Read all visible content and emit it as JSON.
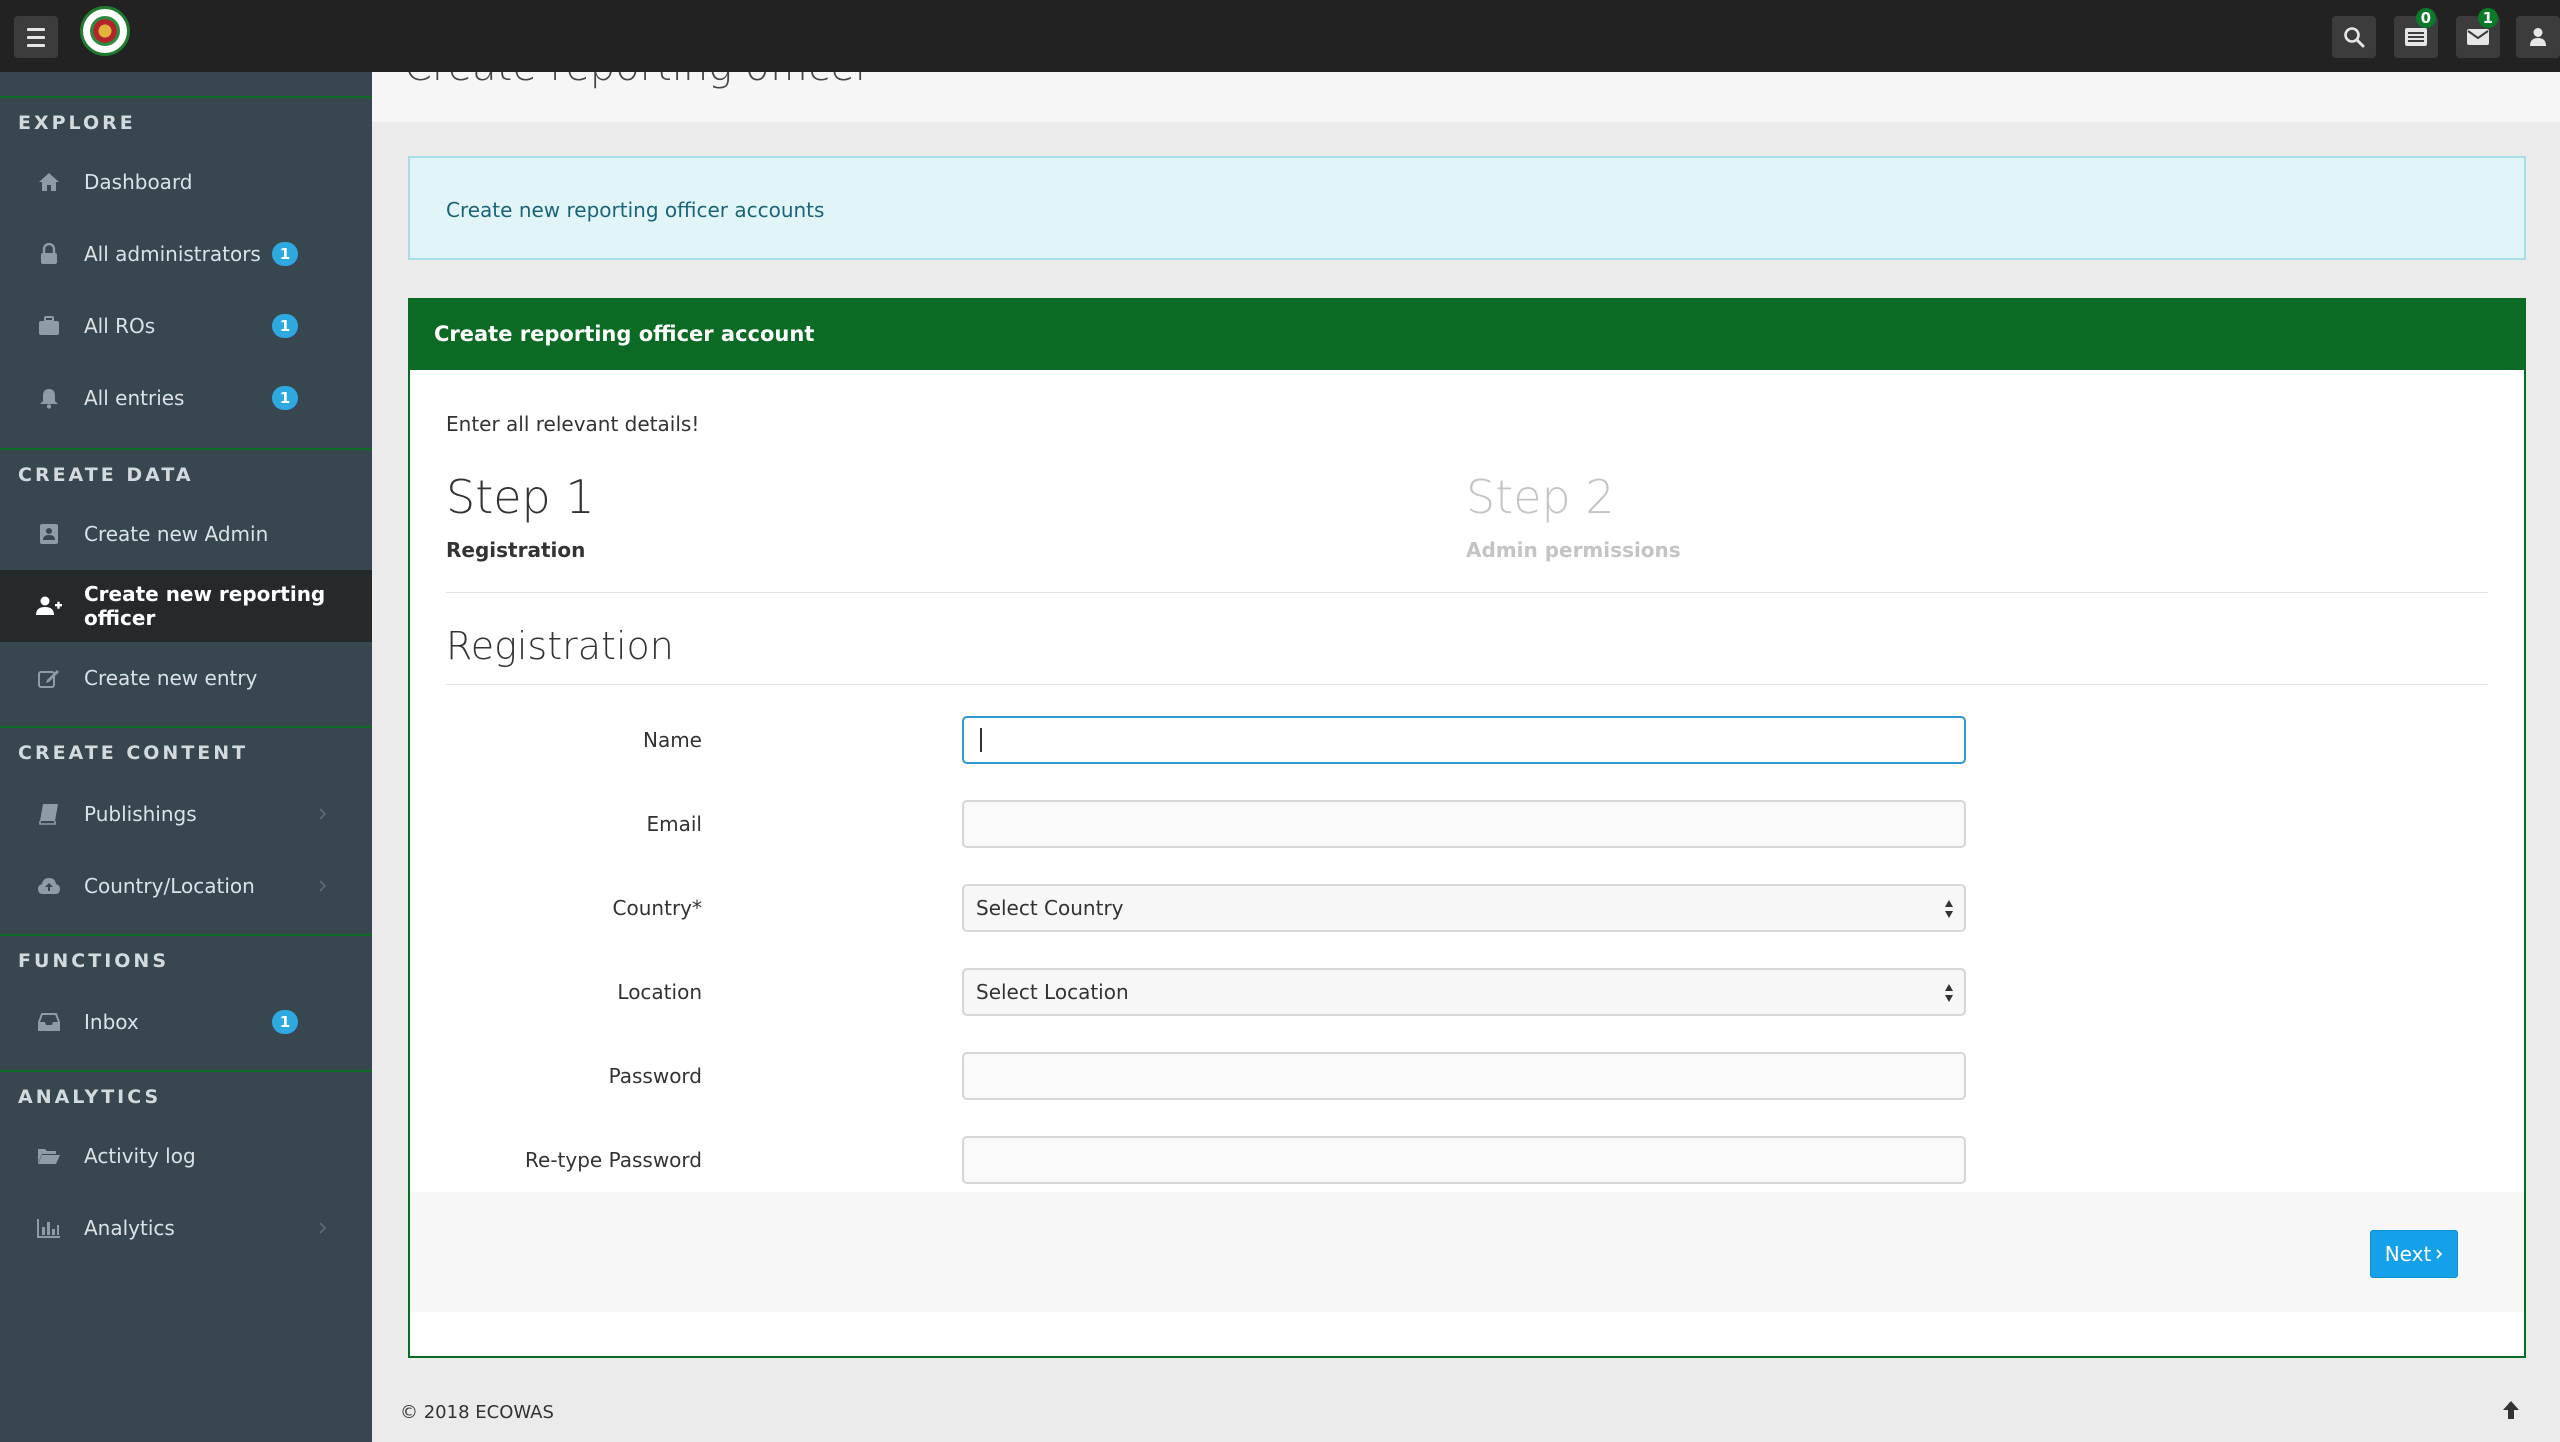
{
  "topbar": {
    "menu_icon": "hamburger-menu-icon",
    "logo_icon": "ecowas-logo-icon",
    "icons": [
      {
        "name": "search-icon"
      },
      {
        "name": "tasks-list-icon",
        "badge": "0"
      },
      {
        "name": "envelope-icon",
        "badge": "1"
      },
      {
        "name": "user-icon"
      }
    ]
  },
  "sidebar": {
    "sections": [
      {
        "title": "EXPLORE"
      },
      {
        "title": "CREATE DATA"
      },
      {
        "title": "CREATE CONTENT"
      },
      {
        "title": "FUNCTIONS"
      },
      {
        "title": "ANALYTICS"
      }
    ],
    "items": [
      {
        "label": "Dashboard",
        "icon": "home-icon"
      },
      {
        "label": "All administrators",
        "icon": "lock-icon",
        "badge": "1"
      },
      {
        "label": "All ROs",
        "icon": "briefcase-icon",
        "badge": "1"
      },
      {
        "label": "All entries",
        "icon": "bell-icon",
        "badge": "1"
      },
      {
        "label": "Create new Admin",
        "icon": "id-card-icon"
      },
      {
        "label": "Create new reporting officer",
        "icon": "user-plus-icon",
        "active": true
      },
      {
        "label": "Create new entry",
        "icon": "edit-icon"
      },
      {
        "label": "Publishings",
        "icon": "book-icon",
        "chevron": true
      },
      {
        "label": "Country/Location",
        "icon": "cloud-upload-icon",
        "chevron": true
      },
      {
        "label": "Inbox",
        "icon": "inbox-icon",
        "badge": "1"
      },
      {
        "label": "Activity log",
        "icon": "folder-open-icon"
      },
      {
        "label": "Analytics",
        "icon": "bar-chart-icon",
        "chevron": true
      }
    ]
  },
  "page": {
    "title": "Create reporting officer",
    "alert": "Create new reporting officer accounts",
    "panel_title": "Create reporting officer account",
    "intro": "Enter all relevant details!",
    "steps": [
      {
        "number": "Step 1",
        "label": "Registration"
      },
      {
        "number": "Step 2",
        "label": "Admin permissions"
      }
    ],
    "section_title": "Registration",
    "fields": [
      {
        "label": "Name",
        "value": "",
        "placeholder": ""
      },
      {
        "label": "Email",
        "value": "",
        "placeholder": ""
      },
      {
        "label": "Country*",
        "value": "Select Country"
      },
      {
        "label": "Location",
        "value": "Select Location"
      },
      {
        "label": "Password",
        "value": "",
        "placeholder": ""
      },
      {
        "label": "Re-type Password",
        "value": "",
        "placeholder": ""
      }
    ],
    "next_label": "Next"
  },
  "footer": {
    "copyright": "© 2018 ECOWAS"
  }
}
